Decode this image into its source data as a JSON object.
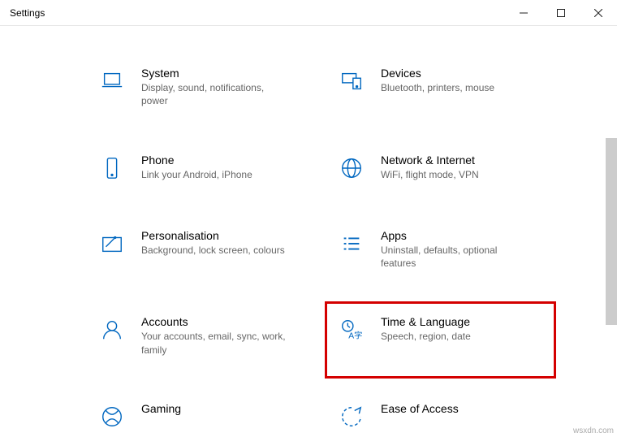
{
  "window": {
    "title": "Settings"
  },
  "tiles": {
    "system": {
      "label": "System",
      "desc": "Display, sound, notifications, power"
    },
    "devices": {
      "label": "Devices",
      "desc": "Bluetooth, printers, mouse"
    },
    "phone": {
      "label": "Phone",
      "desc": "Link your Android, iPhone"
    },
    "network": {
      "label": "Network & Internet",
      "desc": "WiFi, flight mode, VPN"
    },
    "personalisation": {
      "label": "Personalisation",
      "desc": "Background, lock screen, colours"
    },
    "apps": {
      "label": "Apps",
      "desc": "Uninstall, defaults, optional features"
    },
    "accounts": {
      "label": "Accounts",
      "desc": "Your accounts, email, sync, work, family"
    },
    "time_language": {
      "label": "Time & Language",
      "desc": "Speech, region, date"
    },
    "gaming": {
      "label": "Gaming",
      "desc": ""
    },
    "ease_of_access": {
      "label": "Ease of Access",
      "desc": ""
    }
  },
  "watermark": "wsxdn.com"
}
